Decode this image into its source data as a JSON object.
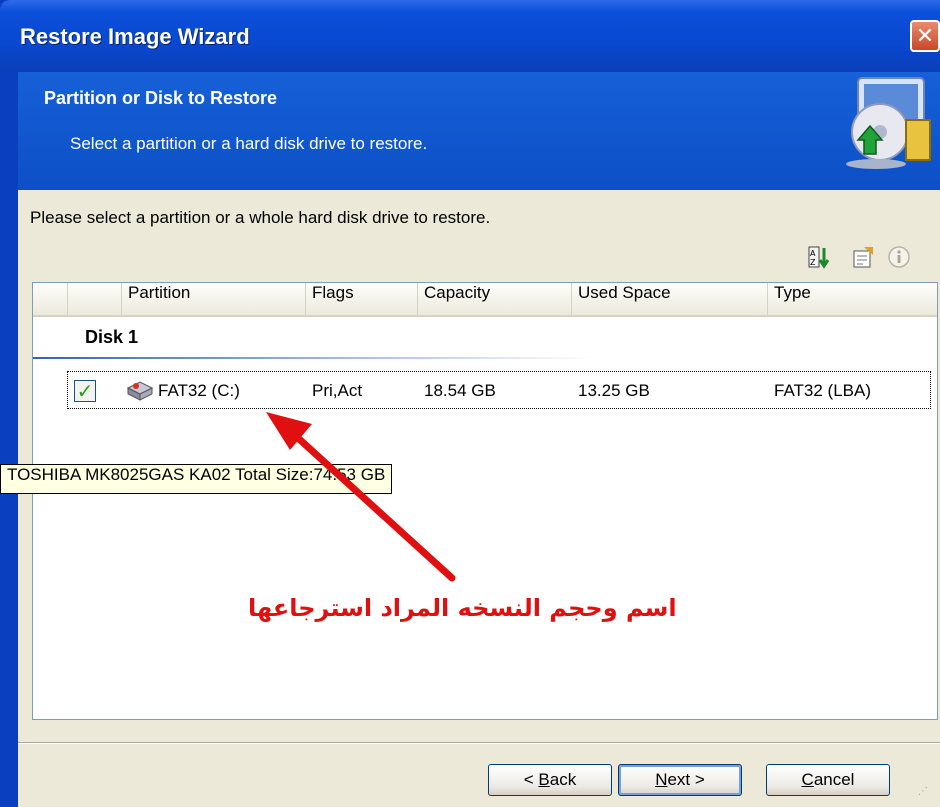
{
  "window": {
    "title": "Restore Image Wizard",
    "close_glyph": "✕"
  },
  "header": {
    "title": "Partition or Disk to Restore",
    "subtitle": "Select a partition or a hard disk drive to restore.",
    "icon": "restore-wizard-icon"
  },
  "content": {
    "instruction": "Please select a partition or a whole hard disk drive to restore.",
    "toolbar_icons": [
      "sort-icon",
      "properties-icon",
      "info-icon"
    ]
  },
  "table": {
    "columns": [
      "Partition",
      "Flags",
      "Capacity",
      "Used Space",
      "Type"
    ],
    "group_label": "Disk 1",
    "rows": [
      {
        "checked": true,
        "checkbox_glyph": "✓",
        "partition": "FAT32 (C:)",
        "flags": "Pri,Act",
        "capacity": "18.54 GB",
        "used_space": "13.25 GB",
        "type": "FAT32 (LBA)"
      }
    ]
  },
  "tooltip": "TOSHIBA MK8025GAS KA02 Total Size:74.53 GB",
  "annotation": "اسم وحجم النسخه المراد استرجاعها",
  "annotation_color": "#e01010",
  "buttons": {
    "back": {
      "prefix": "< ",
      "accel": "B",
      "rest": "ack"
    },
    "next": {
      "accel": "N",
      "rest": "ext >"
    },
    "cancel": {
      "accel": "C",
      "rest": "ancel"
    }
  }
}
